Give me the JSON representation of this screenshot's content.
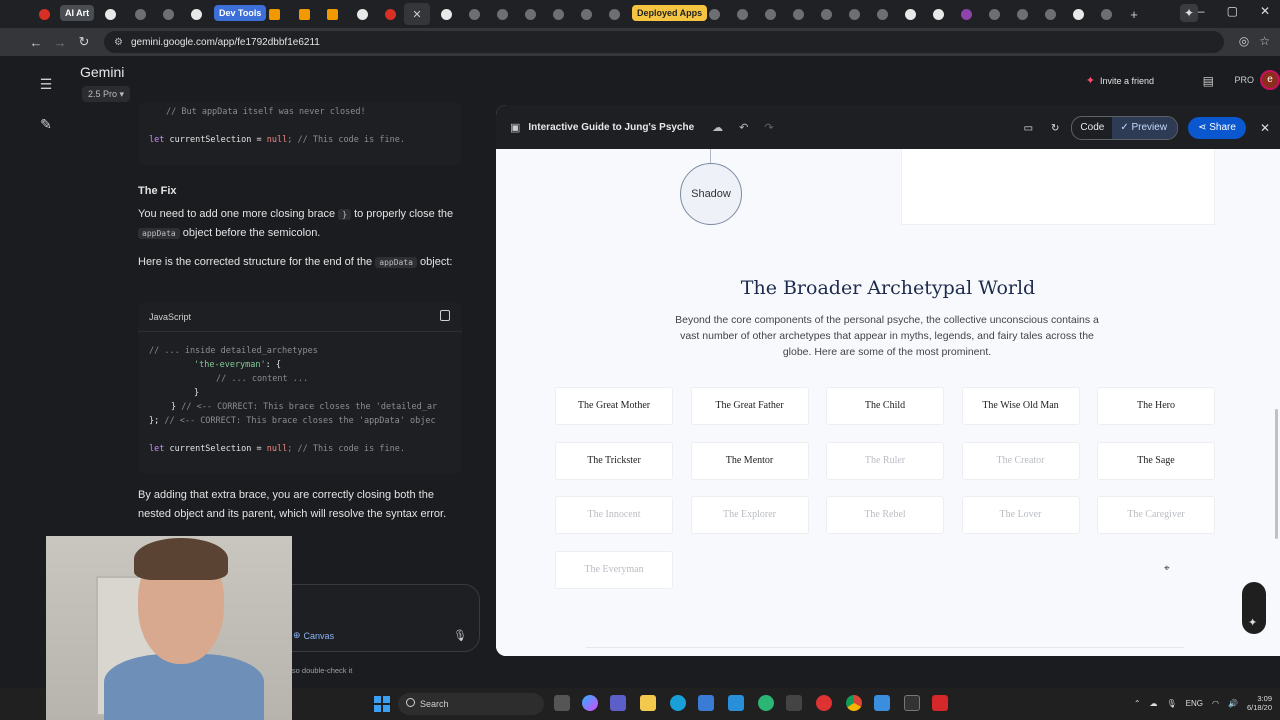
{
  "browser": {
    "tabs": [
      "AI Art",
      "Dev Tools",
      "Deployed Apps"
    ],
    "url": "gemini.google.com/app/fe1792dbbf1e6211"
  },
  "gemini": {
    "brand": "Gemini",
    "model": "2.5 Pro",
    "invite": "Invite a friend",
    "pro": "PRO",
    "avatar_letter": "e"
  },
  "chat": {
    "code1_comment": "// But appData itself was never closed!",
    "code1_line_kw": "let",
    "code1_line_var": "currentSelection",
    "code1_line_eq": "=",
    "code1_line_null": "null",
    "code1_line_comment": "; // This code is fine.",
    "fix_heading": "The Fix",
    "fix_text_1": "You need to add one more closing brace",
    "fix_brace": "}",
    "fix_text_2": "to properly close the",
    "fix_code": "appData",
    "fix_text_3": "object before the semicolon.",
    "struct_text_1": "Here is the corrected structure for the end of the",
    "struct_code": "appData",
    "struct_text_2": "object:",
    "code2_lang": "JavaScript",
    "code2_l1": "// ... inside detailed_archetypes",
    "code2_l2_str": "'the-everyman'",
    "code2_l2_rest": ": {",
    "code2_l3": "// ... content ...",
    "code2_l4": "}",
    "code2_l5_brace": "}",
    "code2_l5_comment": " // <-- CORRECT: This brace closes the 'detailed_ar",
    "code2_l6_brace": "};",
    "code2_l6_comment": " // <-- CORRECT: This brace closes the 'appData' objec",
    "code2_l7_kw": "let",
    "code2_l7_var": "currentSelection",
    "code2_l7_eq": "=",
    "code2_l7_null": "null",
    "code2_l7_comment": "; // This code is fine.",
    "closing_text": "By adding that extra brace, you are correctly closing both the nested object and its parent, which will resolve the syntax error.",
    "canvas_chip": "Canvas",
    "disclaimer": "s, so double-check it"
  },
  "panel": {
    "title": "Interactive Guide to Jung's Psyche",
    "code_label": "Code",
    "preview_label": "Preview",
    "share_label": "Share"
  },
  "content": {
    "shadow_node": "Shadow",
    "section_title": "The Broader Archetypal World",
    "section_desc": "Beyond the core components of the personal psyche, the collective unconscious contains a vast number of other archetypes that appear in myths, legends, and fairy tales across the globe. Here are some of the most prominent.",
    "archetypes": [
      {
        "label": "The Great Mother",
        "faded": false
      },
      {
        "label": "The Great Father",
        "faded": false
      },
      {
        "label": "The Child",
        "faded": false
      },
      {
        "label": "The Wise Old Man",
        "faded": false
      },
      {
        "label": "The Hero",
        "faded": false
      },
      {
        "label": "The Trickster",
        "faded": false
      },
      {
        "label": "The Mentor",
        "faded": false
      },
      {
        "label": "The Ruler",
        "faded": true
      },
      {
        "label": "The Creator",
        "faded": true
      },
      {
        "label": "The Sage",
        "faded": false
      },
      {
        "label": "The Innocent",
        "faded": true
      },
      {
        "label": "The Explorer",
        "faded": true
      },
      {
        "label": "The Rebel",
        "faded": true
      },
      {
        "label": "The Lover",
        "faded": true
      },
      {
        "label": "The Caregiver",
        "faded": true
      },
      {
        "label": "The Everyman",
        "faded": true
      }
    ]
  },
  "taskbar": {
    "search_placeholder": "Search",
    "lang": "ENG",
    "time": "3:09",
    "date": "6/18/20"
  },
  "colors": {
    "accent_blue": "#0b57d0",
    "title_navy": "#1d2c4d"
  }
}
